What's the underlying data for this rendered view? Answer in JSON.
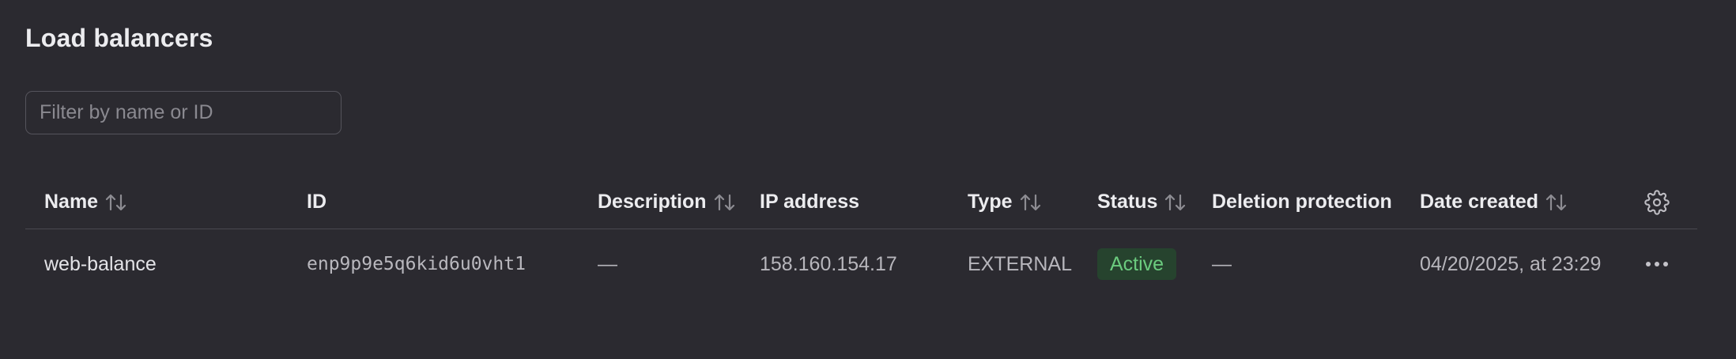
{
  "page": {
    "title": "Load balancers"
  },
  "filter": {
    "placeholder": "Filter by name or ID",
    "value": ""
  },
  "table": {
    "columns": [
      {
        "label": "Name",
        "sortable": true
      },
      {
        "label": "ID",
        "sortable": false
      },
      {
        "label": "Description",
        "sortable": true
      },
      {
        "label": "IP address",
        "sortable": false
      },
      {
        "label": "Type",
        "sortable": true
      },
      {
        "label": "Status",
        "sortable": true
      },
      {
        "label": "Deletion protection",
        "sortable": false
      },
      {
        "label": "Date created",
        "sortable": true
      }
    ],
    "settings_icon": "gear-icon",
    "rows": [
      {
        "name": "web-balance",
        "id": "enp9p9e5q6kid6u0vht1",
        "description": "—",
        "ip_address": "158.160.154.17",
        "type": "EXTERNAL",
        "status": "Active",
        "deletion_protection": "—",
        "date_created": "04/20/2025, at 23:29",
        "actions_icon": "more-horizontal-icon"
      }
    ]
  },
  "colors": {
    "background": "#2b2a30",
    "status_active_bg": "#26432e",
    "status_active_text": "#6bcb7e"
  }
}
